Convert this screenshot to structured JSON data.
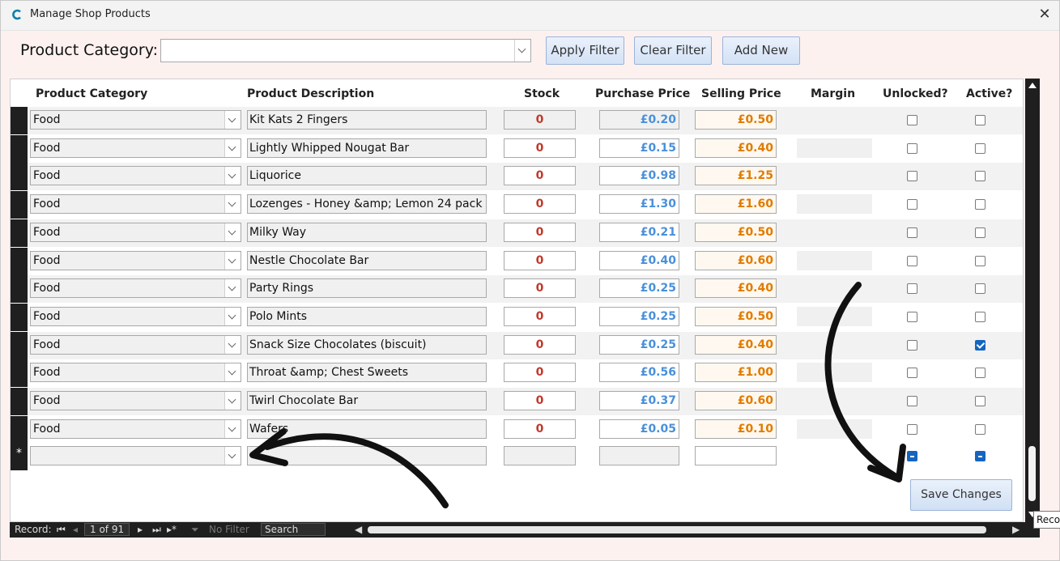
{
  "window": {
    "title": "Manage Shop Products"
  },
  "filter": {
    "label": "Product Category:",
    "value": ""
  },
  "buttons": {
    "apply": "Apply Filter",
    "clear": "Clear Filter",
    "add": "Add New",
    "save": "Save Changes"
  },
  "columns": [
    "Product Category",
    "Product Description",
    "Stock",
    "Purchase Price",
    "Selling Price",
    "Margin",
    "Unlocked?",
    "Active?"
  ],
  "rows": [
    {
      "category": "Food",
      "description": "Kit Kats 2 Fingers",
      "stock": "0",
      "purchase": "£0.20",
      "selling": "£0.50",
      "unlocked": false,
      "active": false
    },
    {
      "category": "Food",
      "description": "Lightly Whipped Nougat Bar",
      "stock": "0",
      "purchase": "£0.15",
      "selling": "£0.40",
      "unlocked": false,
      "active": false
    },
    {
      "category": "Food",
      "description": "Liquorice",
      "stock": "0",
      "purchase": "£0.98",
      "selling": "£1.25",
      "unlocked": false,
      "active": false
    },
    {
      "category": "Food",
      "description": "Lozenges - Honey &amp; Lemon 24 pack",
      "stock": "0",
      "purchase": "£1.30",
      "selling": "£1.60",
      "unlocked": false,
      "active": false
    },
    {
      "category": "Food",
      "description": "Milky Way",
      "stock": "0",
      "purchase": "£0.21",
      "selling": "£0.50",
      "unlocked": false,
      "active": false
    },
    {
      "category": "Food",
      "description": "Nestle Chocolate Bar",
      "stock": "0",
      "purchase": "£0.40",
      "selling": "£0.60",
      "unlocked": false,
      "active": false
    },
    {
      "category": "Food",
      "description": "Party Rings",
      "stock": "0",
      "purchase": "£0.25",
      "selling": "£0.40",
      "unlocked": false,
      "active": false
    },
    {
      "category": "Food",
      "description": "Polo Mints",
      "stock": "0",
      "purchase": "£0.25",
      "selling": "£0.50",
      "unlocked": false,
      "active": false
    },
    {
      "category": "Food",
      "description": "Snack Size Chocolates (biscuit)",
      "stock": "0",
      "purchase": "£0.25",
      "selling": "£0.40",
      "unlocked": false,
      "active": true
    },
    {
      "category": "Food",
      "description": "Throat &amp; Chest Sweets",
      "stock": "0",
      "purchase": "£0.56",
      "selling": "£1.00",
      "unlocked": false,
      "active": false
    },
    {
      "category": "Food",
      "description": "Twirl Chocolate Bar",
      "stock": "0",
      "purchase": "£0.37",
      "selling": "£0.60",
      "unlocked": false,
      "active": false
    },
    {
      "category": "Food",
      "description": "Wafers",
      "stock": "0",
      "purchase": "£0.05",
      "selling": "£0.10",
      "unlocked": false,
      "active": false
    }
  ],
  "new_row": {
    "marker": "*"
  },
  "statusbar": {
    "record_label": "Record:",
    "record_value": "1 of 91",
    "no_filter": "No Filter",
    "search": "Search"
  },
  "tooltip": "Reco",
  "colors": {
    "stock": "#c0392b",
    "purchase": "#4a90d9",
    "selling": "#e07b00",
    "checked": "#1565c0"
  }
}
